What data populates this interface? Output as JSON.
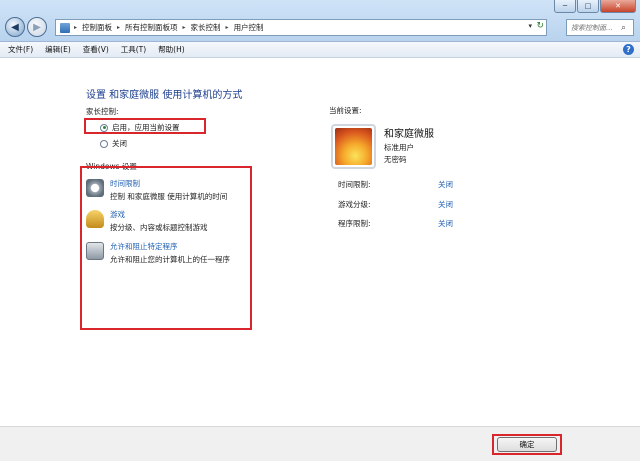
{
  "window": {
    "minimize": "─",
    "maximize": "□",
    "close": "✕"
  },
  "address": {
    "crumbs": [
      "控制面板",
      "所有控制面板项",
      "家长控制",
      "用户控制"
    ],
    "separator": "▸",
    "dropdown": "▾",
    "refresh": "↻"
  },
  "search": {
    "placeholder": "搜索控制面..."
  },
  "menu": [
    "文件(F)",
    "编辑(E)",
    "查看(V)",
    "工具(T)",
    "帮助(H)"
  ],
  "help_glyph": "?",
  "page_title": "设置 和家庭微服 使用计算机的方式",
  "parental": {
    "label": "家长控制:",
    "on": "启用，应用当前设置",
    "off": "关闭",
    "selected": "on"
  },
  "windows_settings": {
    "label": "Windows 设置",
    "items": [
      {
        "link": "时间限制",
        "desc": "控制 和家庭微服 使用计算机的时间",
        "icon": "clock-icon"
      },
      {
        "link": "游戏",
        "desc": "按分级、内容或标题控制游戏",
        "icon": "game-trophy-icon"
      },
      {
        "link": "允许和阻止特定程序",
        "desc": "允许和阻止您的计算机上的任一程序",
        "icon": "program-icon"
      }
    ]
  },
  "current": {
    "label": "当前设置:",
    "user_name": "和家庭微服",
    "role": "标准用户",
    "password": "无密码",
    "rows": [
      {
        "key": "时间限制:",
        "value": "关闭"
      },
      {
        "key": "游戏分级:",
        "value": "关闭"
      },
      {
        "key": "程序限制:",
        "value": "关闭"
      }
    ]
  },
  "footer": {
    "ok": "确定"
  },
  "colors": {
    "highlight": "#d9262c",
    "link": "#1f5fb0",
    "title": "#1d3f8f"
  }
}
